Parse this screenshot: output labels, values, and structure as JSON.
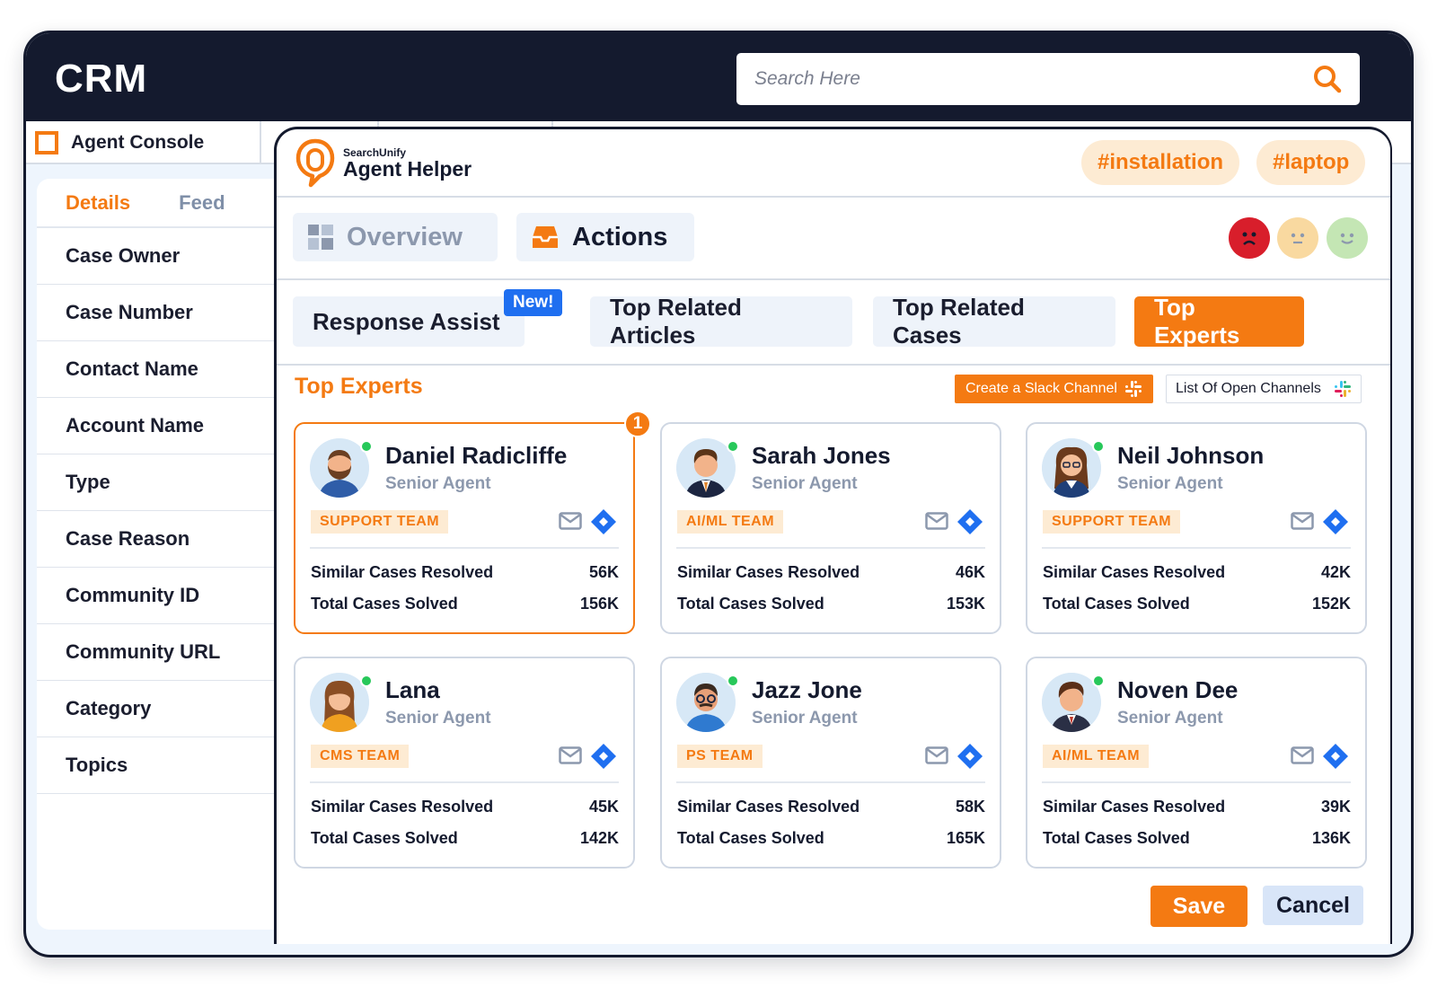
{
  "app": {
    "title": "CRM"
  },
  "search": {
    "placeholder": "Search Here"
  },
  "console": {
    "tab_label": "Agent Console"
  },
  "left_panel": {
    "tabs": [
      {
        "label": "Details"
      },
      {
        "label": "Feed"
      }
    ],
    "fields": [
      {
        "label": "Case Owner"
      },
      {
        "label": "Case Number"
      },
      {
        "label": "Contact Name"
      },
      {
        "label": "Account Name"
      },
      {
        "label": "Type"
      },
      {
        "label": "Case Reason"
      },
      {
        "label": "Community ID"
      },
      {
        "label": "Community URL"
      },
      {
        "label": "Category"
      },
      {
        "label": "Topics"
      }
    ]
  },
  "helper": {
    "brand_small": "SearchUnify",
    "brand_name": "Agent Helper",
    "tags": [
      {
        "label": "#installation"
      },
      {
        "label": "#laptop"
      }
    ],
    "nav": [
      {
        "label": "Overview",
        "icon": "grid-icon"
      },
      {
        "label": "Actions",
        "icon": "inbox-icon"
      }
    ],
    "sentiment": [
      {
        "icon": "sad-face-icon",
        "color": "#d81e2b"
      },
      {
        "icon": "neutral-face-icon",
        "color": "#f9d9a0"
      },
      {
        "icon": "happy-face-icon",
        "color": "#c4e6b4"
      }
    ],
    "subtabs": [
      {
        "label": "Response Assist",
        "badge": "New!"
      },
      {
        "label": "Top Related Articles"
      },
      {
        "label": "Top Related Cases"
      },
      {
        "label": "Top Experts"
      }
    ],
    "section_title": "Top Experts",
    "slack_button": "Create a Slack Channel",
    "open_channels_button": "List Of Open Channels",
    "experts": [
      {
        "name": "Daniel Radicliffe",
        "role": "Senior Agent",
        "team": "SUPPORT TEAM",
        "similar_label": "Similar Cases Resolved",
        "similar": "56K",
        "total_label": "Total Cases Solved",
        "total": "156K",
        "rank": "1"
      },
      {
        "name": "Sarah Jones",
        "role": "Senior Agent",
        "team": "AI/ML TEAM",
        "similar_label": "Similar Cases Resolved",
        "similar": "46K",
        "total_label": "Total Cases Solved",
        "total": "153K"
      },
      {
        "name": "Neil Johnson",
        "role": "Senior Agent",
        "team": "SUPPORT  TEAM",
        "similar_label": "Similar Cases Resolved",
        "similar": "42K",
        "total_label": "Total Cases Solved",
        "total": "152K"
      },
      {
        "name": "Lana",
        "role": "Senior Agent",
        "team": "CMS TEAM",
        "similar_label": "Similar Cases Resolved",
        "similar": "45K",
        "total_label": "Total Cases Solved",
        "total": "142K"
      },
      {
        "name": "Jazz Jone",
        "role": "Senior Agent",
        "team": "PS TEAM",
        "similar_label": "Similar Cases Resolved",
        "similar": "58K",
        "total_label": "Total Cases Solved",
        "total": "165K"
      },
      {
        "name": "Noven Dee",
        "role": "Senior Agent",
        "team": "AI/ML TEAM",
        "similar_label": "Similar Cases Resolved",
        "similar": "39K",
        "total_label": "Total Cases Solved",
        "total": "136K"
      }
    ],
    "save_label": "Save",
    "cancel_label": "Cancel"
  },
  "colors": {
    "accent": "#f47a12",
    "dark": "#141a2e",
    "online": "#27c85a",
    "jira": "#1f6ff0"
  }
}
